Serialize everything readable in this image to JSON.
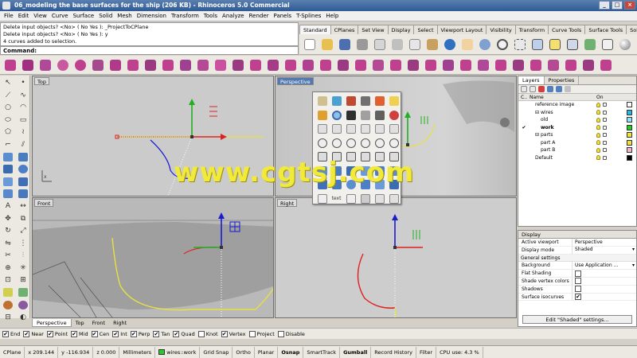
{
  "window": {
    "title": "06_modeling the base surfaces for the ship (206 KB) - Rhinoceros 5.0 Commercial",
    "min": "_",
    "max": "□",
    "close": "×"
  },
  "menu": [
    "File",
    "Edit",
    "View",
    "Curve",
    "Surface",
    "Solid",
    "Mesh",
    "Dimension",
    "Transform",
    "Tools",
    "Analyze",
    "Render",
    "Panels",
    "T-Splines",
    "Help"
  ],
  "command": {
    "history": [
      "Delete input objects? <No> ( No  Yes ): _ProjectToCPlane",
      "Delete input objects? <No> ( No  Yes ): y",
      "4 curves added to selection."
    ],
    "prompt": "Command:"
  },
  "toolbar_tabs": [
    "Standard",
    "CPlanes",
    "Set View",
    "Display",
    "Select",
    "Viewport Layout",
    "Visibility",
    "Transform",
    "Curve Tools",
    "Surface Tools",
    "Solid To"
  ],
  "viewports": {
    "top": "Top",
    "perspective": "Perspective",
    "front": "Front",
    "right": "Right"
  },
  "viewport_tabs": [
    "Perspective",
    "Top",
    "Front",
    "Right"
  ],
  "popup": {
    "label": "text"
  },
  "watermark": "www.cgtsj.com",
  "layers": {
    "tabs": [
      "Layers",
      "Properties"
    ],
    "headers": {
      "current": "C..",
      "name": "Name",
      "on": "On",
      "color": ""
    },
    "rows": [
      {
        "name": "reference image",
        "indent": 1,
        "color": "#ffffff",
        "current": false,
        "expander": ""
      },
      {
        "name": "wires",
        "indent": 1,
        "color": "#22b8e8",
        "current": false,
        "expander": "⊟"
      },
      {
        "name": "old",
        "indent": 2,
        "color": "#8be8ff",
        "current": false,
        "expander": ""
      },
      {
        "name": "work",
        "indent": 2,
        "color": "#22cc22",
        "current": true,
        "expander": ""
      },
      {
        "name": "parts",
        "indent": 1,
        "color": "#f0e040",
        "current": false,
        "expander": "⊟"
      },
      {
        "name": "part A",
        "indent": 2,
        "color": "#f0e040",
        "current": false,
        "expander": ""
      },
      {
        "name": "part B",
        "indent": 2,
        "color": "#f4b8c8",
        "current": false,
        "expander": ""
      },
      {
        "name": "Default",
        "indent": 1,
        "color": "#000000",
        "current": false,
        "expander": ""
      }
    ]
  },
  "display": {
    "title": "Display",
    "active_viewport": {
      "label": "Active viewport",
      "value": "Perspective"
    },
    "display_mode": {
      "label": "Display mode",
      "value": "Shaded"
    },
    "section": "General settings",
    "settings": [
      {
        "label": "Background",
        "value": "Use Application ...",
        "type": "select"
      },
      {
        "label": "Flat Shading",
        "value": "",
        "type": "check",
        "checked": false
      },
      {
        "label": "Shade vertex colors",
        "value": "",
        "type": "check",
        "checked": false
      },
      {
        "label": "Shadows",
        "value": "",
        "type": "check",
        "checked": false
      },
      {
        "label": "Surface isocurves",
        "value": "",
        "type": "check",
        "checked": true
      }
    ],
    "button": "Edit \"Shaded\" settings..."
  },
  "osnap": [
    {
      "label": "End",
      "checked": true
    },
    {
      "label": "Near",
      "checked": true
    },
    {
      "label": "Point",
      "checked": true
    },
    {
      "label": "Mid",
      "checked": true
    },
    {
      "label": "Cen",
      "checked": true
    },
    {
      "label": "Int",
      "checked": true
    },
    {
      "label": "Perp",
      "checked": true
    },
    {
      "label": "Tan",
      "checked": true
    },
    {
      "label": "Quad",
      "checked": true
    },
    {
      "label": "Knot",
      "checked": false
    },
    {
      "label": "Vertex",
      "checked": true
    },
    {
      "label": "Project",
      "checked": false
    },
    {
      "label": "Disable",
      "checked": false
    }
  ],
  "status": {
    "cplane": "CPlane",
    "x": "x 209.144",
    "y": "y -116.934",
    "z": "z 0.000",
    "units": "Millimeters",
    "layer": "wires::work",
    "buttons": [
      "Grid Snap",
      "Ortho",
      "Planar",
      "Osnap",
      "SmartTrack",
      "Gumball",
      "Record History",
      "Filter"
    ],
    "bold_buttons": [
      "Osnap",
      "Gumball"
    ],
    "cpu": "CPU use: 4.3 %"
  },
  "colors": {
    "accent": "#5478b0",
    "axis_x": "#e02020",
    "axis_y": "#20b020",
    "axis_z": "#2020e0",
    "curve_yellow": "#e8e040",
    "watermark": "#f2ea3a"
  }
}
